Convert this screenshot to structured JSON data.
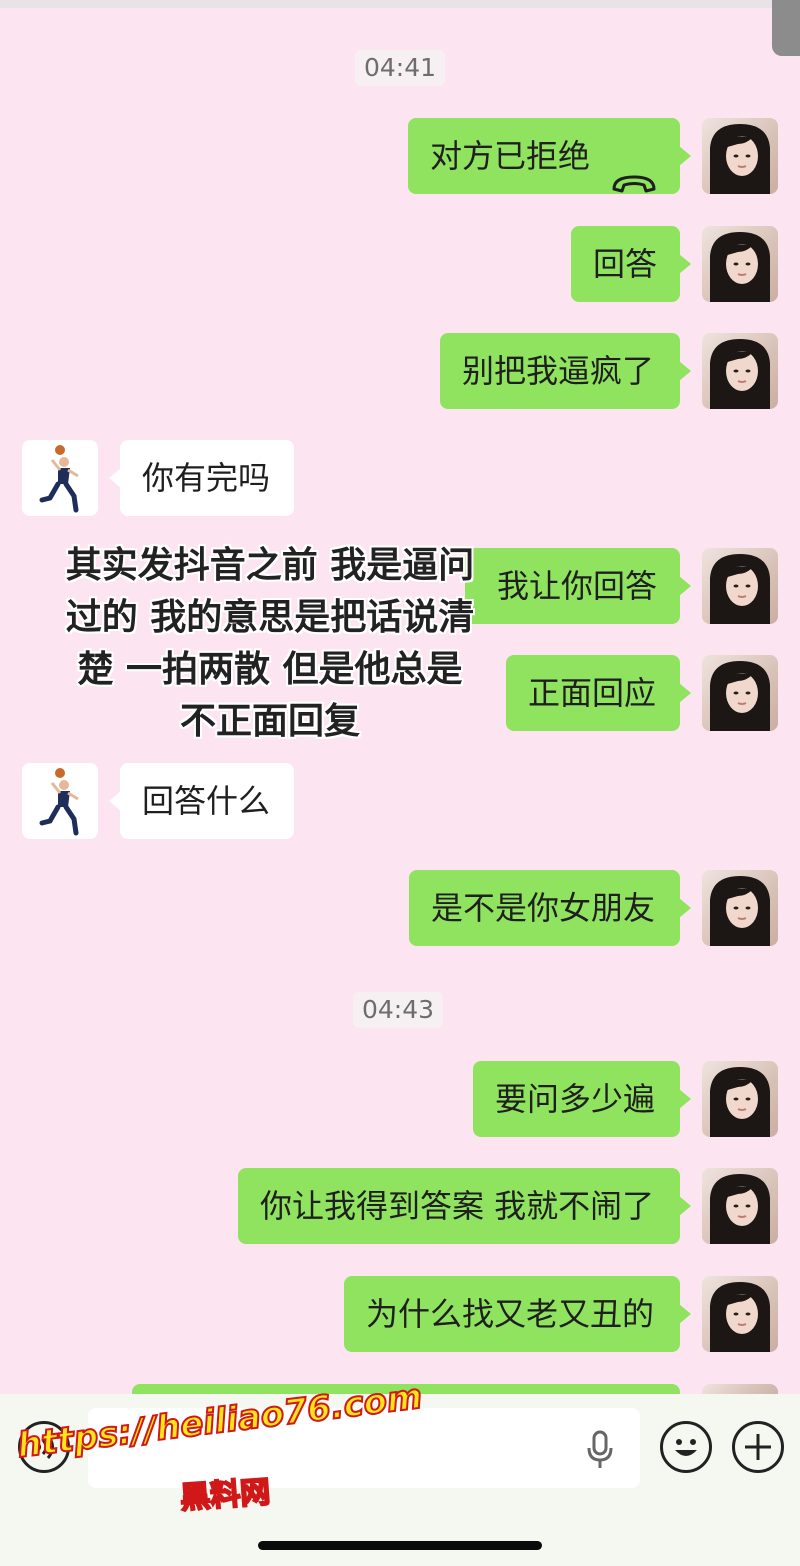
{
  "timestamps": [
    "04:41",
    "04:43"
  ],
  "messages": {
    "m1": "对方已拒绝",
    "m2": "回答",
    "m3": "别把我逼疯了",
    "m4": "你有完吗",
    "m5": "我让你回答",
    "m6": "正面回应",
    "m7": "回答什么",
    "m8": "是不是你女朋友",
    "m9": "要问多少遍",
    "m10": "你让我得到答案 我就不闹了",
    "m11": "为什么找又老又丑的"
  },
  "overlay_caption": [
    "其实发抖音之前 我是逼问",
    "过的 我的意思是把话说清",
    "楚 一拍两散 但是他总是",
    "不正面回复"
  ],
  "watermark": {
    "url": "https://heiliao76.com",
    "name": "黑料网"
  },
  "icons": [
    "call-declined-icon",
    "voice-toggle-icon",
    "microphone-icon",
    "emoji-icon",
    "plus-icon"
  ],
  "colors": {
    "background": "#fce4f0",
    "outgoing_bubble": "#8fe35f",
    "incoming_bubble": "#ffffff",
    "watermark_fill": "#ffe61a",
    "watermark_stroke": "#d01818"
  }
}
